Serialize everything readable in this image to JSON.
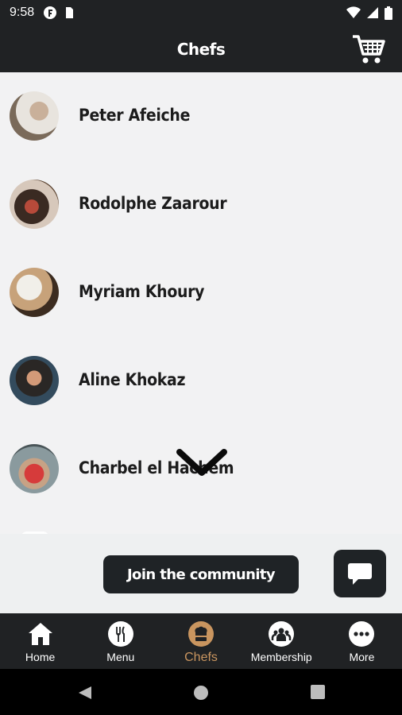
{
  "status_bar": {
    "time": "9:58"
  },
  "app_bar": {
    "title": "Chefs"
  },
  "chefs": [
    {
      "name": "Peter Afeiche"
    },
    {
      "name": "Rodolphe Zaarour"
    },
    {
      "name": "Myriam Khoury"
    },
    {
      "name": "Aline Khokaz"
    },
    {
      "name": "Charbel el Hachem"
    }
  ],
  "footer": {
    "join_label": "Join the community"
  },
  "bottom_nav": {
    "items": [
      {
        "label": "Home",
        "icon": "home-icon"
      },
      {
        "label": "Menu",
        "icon": "fork-knife-icon"
      },
      {
        "label": "Chefs",
        "icon": "chef-hat-icon",
        "active": true
      },
      {
        "label": "Membership",
        "icon": "group-icon"
      },
      {
        "label": "More",
        "icon": "more-dots-icon"
      }
    ]
  },
  "colors": {
    "bar_bg": "#202224",
    "active_tab": "#c9955f",
    "content_bg": "#f2f2f3"
  }
}
